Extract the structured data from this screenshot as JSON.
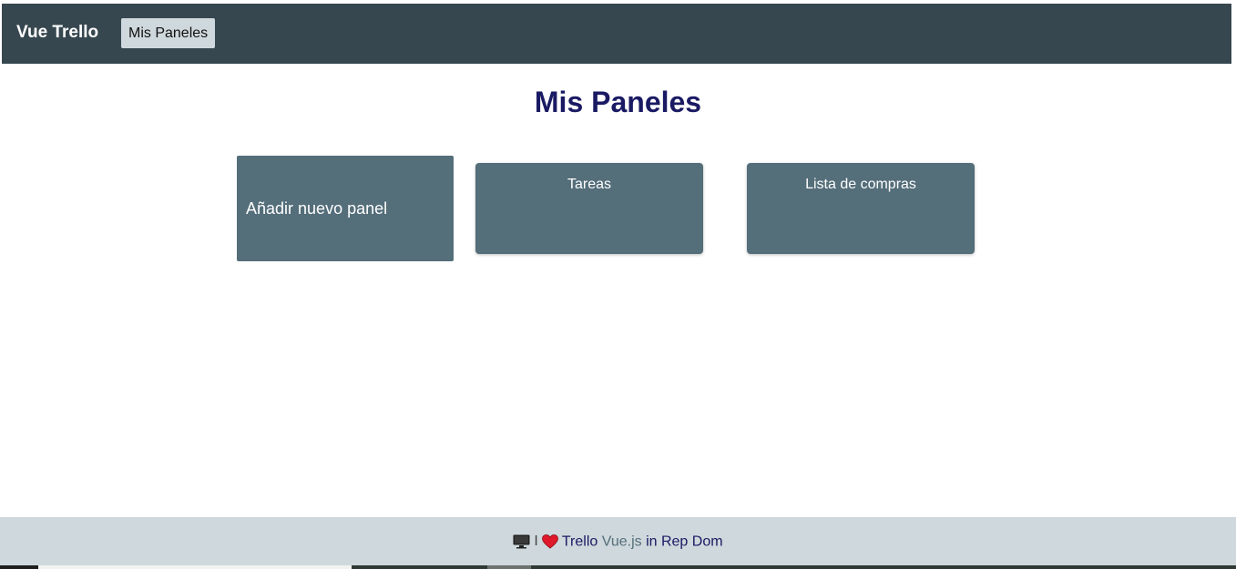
{
  "navbar": {
    "brand": "Vue Trello",
    "boards_button": "Mis Paneles"
  },
  "main": {
    "title": "Mis Paneles",
    "add_panel_label": "Añadir nuevo panel",
    "boards": [
      {
        "title": "Tareas"
      },
      {
        "title": "Lista de compras"
      }
    ]
  },
  "footer": {
    "monitor_icon": "monitor-icon",
    "separator": "I",
    "heart_icon": "heart-icon",
    "text_trello": "Trello",
    "text_vue": "Vue.js",
    "text_rest": "in Rep Dom"
  },
  "colors": {
    "navbar_bg": "#37474f",
    "card_bg": "#546e7a",
    "title_color": "#1a1a64",
    "footer_bg": "#cfd8dc",
    "heart": "#e0192a"
  }
}
